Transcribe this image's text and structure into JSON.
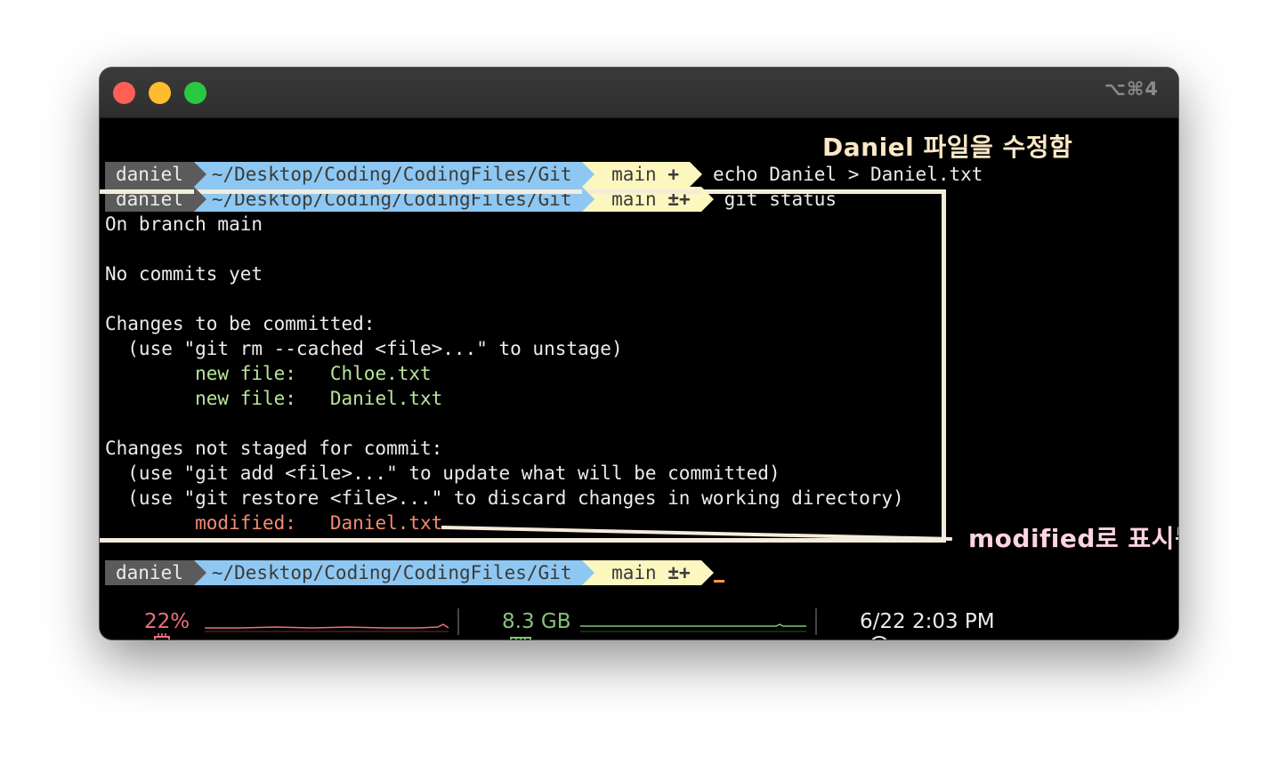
{
  "window": {
    "shortcut": "⌥⌘4",
    "traffic_lights": [
      "close",
      "minimize",
      "zoom"
    ],
    "colors": {
      "close": "#ff5f57",
      "minimize": "#febc2e",
      "zoom": "#28c840"
    }
  },
  "prompts": [
    {
      "user": "daniel",
      "path": "~/Desktop/Coding/CodingFiles/Git",
      "branch_icon": "",
      "branch": "main",
      "status": "+",
      "command": "echo Daniel > Daniel.txt"
    },
    {
      "user": "daniel",
      "path": "~/Desktop/Coding/CodingFiles/Git",
      "branch_icon": "",
      "branch": "main",
      "status": "±+",
      "command": "git status"
    },
    {
      "user": "daniel",
      "path": "~/Desktop/Coding/CodingFiles/Git",
      "branch_icon": "",
      "branch": "main",
      "status": "±+",
      "command": ""
    }
  ],
  "output": {
    "on_branch": "On branch main",
    "no_commits": "No commits yet",
    "staged_header": "Changes to be committed:",
    "staged_hint": "  (use \"git rm --cached <file>...\" to unstage)",
    "staged_files": [
      {
        "label": "        new file:   ",
        "file": "Chloe.txt"
      },
      {
        "label": "        new file:   ",
        "file": "Daniel.txt"
      }
    ],
    "unstaged_header": "Changes not staged for commit:",
    "unstaged_hint_1": "  (use \"git add <file>...\" to update what will be committed)",
    "unstaged_hint_2": "  (use \"git restore <file>...\" to discard changes in working directory)",
    "modified": {
      "label": "        modified:   ",
      "file": "Daniel.txt"
    }
  },
  "annotations": {
    "top": "Daniel 파일을 수정함",
    "right": "modified로 표시됨"
  },
  "status_bar": {
    "cpu_icon": "cpu-icon",
    "cpu": "22%",
    "mem_icon": "memory-icon",
    "mem": "8.3 GB",
    "clock_icon": "clock-icon",
    "datetime": "6/22 2:03 PM",
    "colors": {
      "cpu": "#e8707a",
      "mem": "#86c27a",
      "time": "#ececec"
    }
  }
}
